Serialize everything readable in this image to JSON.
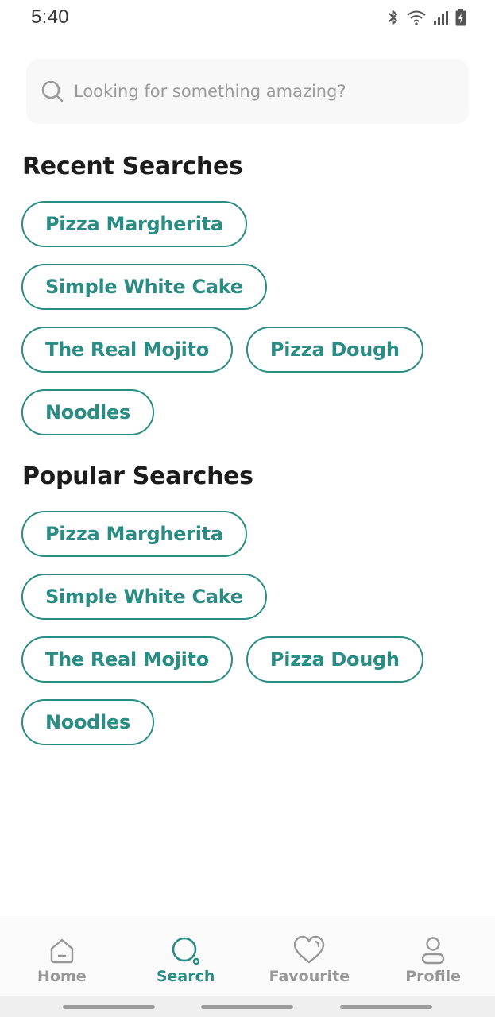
{
  "status_bar": {
    "time": "5:40",
    "icons": [
      "bluetooth-icon",
      "wifi-icon",
      "signal-icon",
      "battery-charging-icon"
    ]
  },
  "search": {
    "placeholder": "Looking for something amazing?",
    "value": ""
  },
  "recent": {
    "title": "Recent Searches",
    "items": [
      "Pizza Margherita",
      "Simple White Cake",
      "The Real Mojito",
      "Pizza Dough",
      "Noodles"
    ]
  },
  "popular": {
    "title": "Popular Searches",
    "items": [
      "Pizza Margherita",
      "Simple White Cake",
      "The Real Mojito",
      "Pizza Dough",
      "Noodles"
    ]
  },
  "bottom_nav": {
    "items": [
      {
        "label": "Home",
        "icon": "home-icon",
        "active": false
      },
      {
        "label": "Search",
        "icon": "search-icon",
        "active": true
      },
      {
        "label": "Favourite",
        "icon": "heart-icon",
        "active": false
      },
      {
        "label": "Profile",
        "icon": "profile-icon",
        "active": false
      }
    ]
  },
  "colors": {
    "accent": "#2a8c83",
    "inactive": "#979797",
    "search_bg": "#f8f8f8"
  }
}
